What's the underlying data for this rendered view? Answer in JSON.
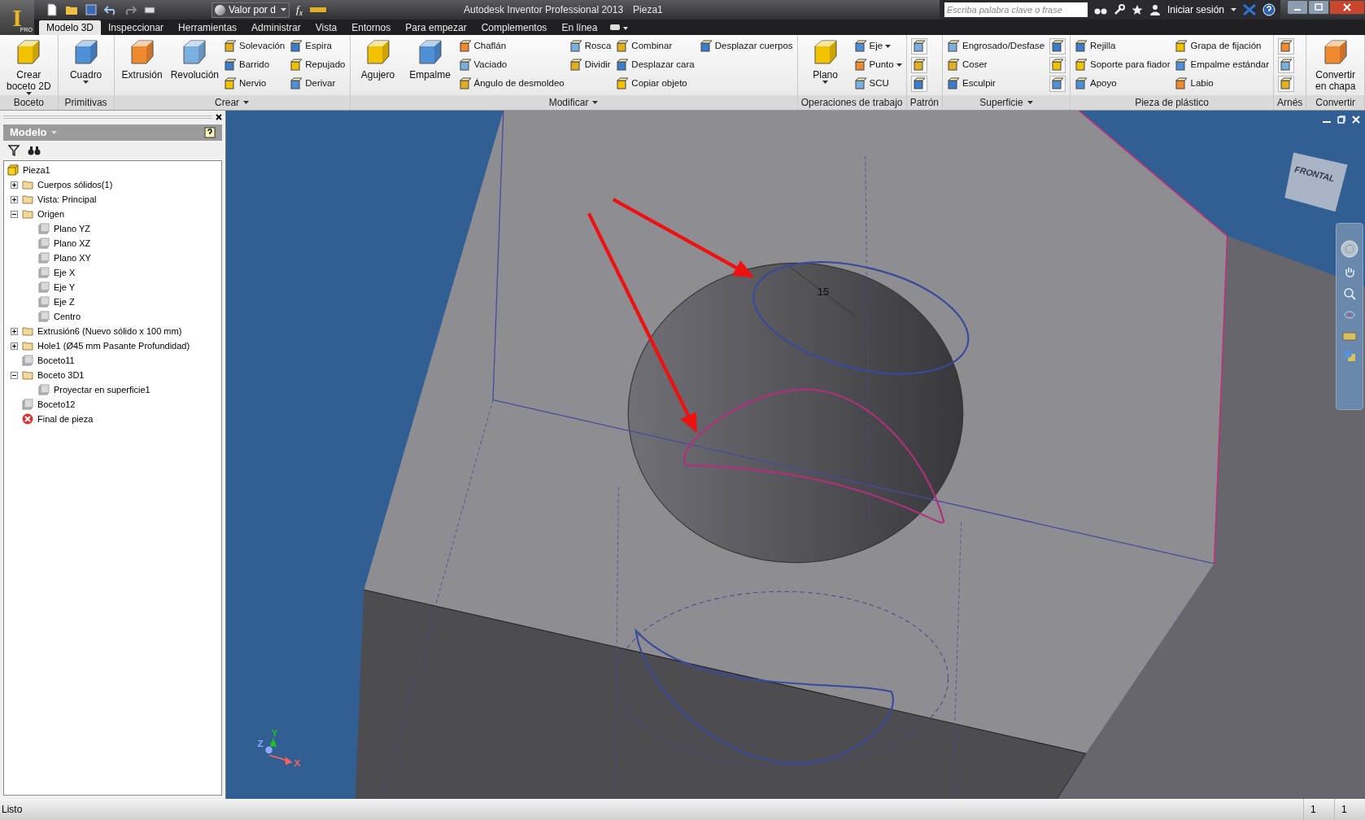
{
  "title_bar": {
    "logo_letter": "I",
    "logo_badge": "PRO",
    "style_dropdown": "Valor por d",
    "formula_label": "f$_{x}$",
    "title": "Autodesk Inventor Professional 2013",
    "document": "Pieza1",
    "search_placeholder": "Escriba palabra clave o frase",
    "sign_in": "Iniciar sesión"
  },
  "tabs": [
    {
      "label": "Modelo 3D",
      "selected": true
    },
    {
      "label": "Inspeccionar",
      "selected": false
    },
    {
      "label": "Herramientas",
      "selected": false
    },
    {
      "label": "Administrar",
      "selected": false
    },
    {
      "label": "Vista",
      "selected": false
    },
    {
      "label": "Entornos",
      "selected": false
    },
    {
      "label": "Para empezar",
      "selected": false
    },
    {
      "label": "Complementos",
      "selected": false
    },
    {
      "label": "En línea",
      "selected": false
    }
  ],
  "ribbon": {
    "panels": [
      {
        "title": "Boceto",
        "has_menu": false,
        "columns": [
          {
            "kind": "large",
            "label": "Crear boceto 2D",
            "dropdown": true
          }
        ]
      },
      {
        "title": "Primitivas",
        "has_menu": false,
        "columns": [
          {
            "kind": "large",
            "label": "Cuadro",
            "dropdown": true
          }
        ]
      },
      {
        "title": "Crear",
        "has_menu": true,
        "columns": [
          {
            "kind": "large",
            "label": "Extrusión",
            "dropdown": false
          },
          {
            "kind": "large",
            "label": "Revolución",
            "dropdown": false
          },
          {
            "kind": "stack",
            "items": [
              {
                "label": "Solevación",
                "dropdown": false
              },
              {
                "label": "Barrido",
                "dropdown": false
              },
              {
                "label": "Nervio",
                "dropdown": false
              }
            ]
          },
          {
            "kind": "stack",
            "items": [
              {
                "label": "Espira",
                "dropdown": false
              },
              {
                "label": "Repujado",
                "dropdown": false
              },
              {
                "label": "Derivar",
                "dropdown": false
              }
            ]
          }
        ]
      },
      {
        "title": "Modificar",
        "has_menu": true,
        "columns": [
          {
            "kind": "large",
            "label": "Agujero",
            "dropdown": false
          },
          {
            "kind": "large",
            "label": "Empalme",
            "dropdown": false
          },
          {
            "kind": "stack",
            "items": [
              {
                "label": "Chaflán",
                "dropdown": false
              },
              {
                "label": "Vaciado",
                "dropdown": false
              },
              {
                "label": "Ángulo de desmoldeo",
                "dropdown": false
              }
            ]
          },
          {
            "kind": "stack",
            "items": [
              {
                "label": "Rosca",
                "dropdown": false
              },
              {
                "label": "Dividir",
                "dropdown": false
              }
            ]
          },
          {
            "kind": "stack",
            "items": [
              {
                "label": "Combinar",
                "dropdown": false
              },
              {
                "label": "Desplazar cara",
                "dropdown": false
              },
              {
                "label": "Copiar objeto",
                "dropdown": false
              }
            ]
          },
          {
            "kind": "stack",
            "items": [
              {
                "label": "Desplazar cuerpos",
                "dropdown": false
              }
            ]
          }
        ]
      },
      {
        "title": "Operaciones de trabajo",
        "has_menu": false,
        "columns": [
          {
            "kind": "large",
            "label": "Plano",
            "dropdown": true
          },
          {
            "kind": "stack",
            "items": [
              {
                "label": "Eje",
                "dropdown": true
              },
              {
                "label": "Punto",
                "dropdown": true
              },
              {
                "label": "SCU",
                "dropdown": false
              }
            ]
          }
        ]
      },
      {
        "title": "Patrón",
        "has_menu": false,
        "columns": [
          {
            "kind": "icons"
          }
        ]
      },
      {
        "title": "Superficie",
        "has_menu": true,
        "columns": [
          {
            "kind": "stack",
            "items": [
              {
                "label": "Engrosado/Desfase",
                "dropdown": false
              },
              {
                "label": "Coser",
                "dropdown": false
              },
              {
                "label": "Esculpir",
                "dropdown": false
              }
            ]
          },
          {
            "kind": "icons"
          }
        ]
      },
      {
        "title": "Pieza de plástico",
        "has_menu": false,
        "columns": [
          {
            "kind": "stack",
            "items": [
              {
                "label": "Rejilla",
                "dropdown": false
              },
              {
                "label": "Soporte para fiador",
                "dropdown": false
              },
              {
                "label": "Apoyo",
                "dropdown": false
              }
            ]
          },
          {
            "kind": "stack",
            "items": [
              {
                "label": "Grapa de fijación",
                "dropdown": false
              },
              {
                "label": "Empalme estándar",
                "dropdown": false
              },
              {
                "label": "Labio",
                "dropdown": false
              }
            ]
          }
        ]
      },
      {
        "title": "Arnés",
        "has_menu": false,
        "columns": [
          {
            "kind": "icons"
          }
        ]
      },
      {
        "title": "Convertir",
        "has_menu": false,
        "columns": [
          {
            "kind": "large",
            "label": "Convertir en chapa",
            "dropdown": false
          }
        ]
      }
    ]
  },
  "browser": {
    "title": "Modelo",
    "tree": [
      {
        "label": "Pieza1",
        "kind": "root",
        "children": [
          {
            "label": "Cuerpos sólidos(1)",
            "kind": "collapsible",
            "expanded": false
          },
          {
            "label": "Vista: Principal",
            "kind": "collapsible",
            "expanded": false
          },
          {
            "label": "Origen",
            "kind": "collapsible",
            "expanded": true,
            "children": [
              {
                "label": "Plano YZ",
                "kind": "leaf"
              },
              {
                "label": "Plano XZ",
                "kind": "leaf"
              },
              {
                "label": "Plano XY",
                "kind": "leaf"
              },
              {
                "label": "Eje X",
                "kind": "leaf"
              },
              {
                "label": "Eje Y",
                "kind": "leaf"
              },
              {
                "label": "Eje Z",
                "kind": "leaf"
              },
              {
                "label": "Centro",
                "kind": "leaf"
              }
            ]
          },
          {
            "label": "Extrusión6 (Nuevo sólido x 100 mm)",
            "kind": "collapsible",
            "expanded": false
          },
          {
            "label": "Hole1 (Ø45 mm Pasante Profundidad)",
            "kind": "collapsible",
            "expanded": false
          },
          {
            "label": "Boceto11",
            "kind": "leaf"
          },
          {
            "label": "Boceto 3D1",
            "kind": "collapsible",
            "expanded": true,
            "children": [
              {
                "label": "Proyectar en superficie1",
                "kind": "leaf"
              }
            ]
          },
          {
            "label": "Boceto12",
            "kind": "leaf"
          },
          {
            "label": "Final de pieza",
            "kind": "end"
          }
        ]
      }
    ]
  },
  "viewport": {
    "dimension": "15",
    "viewcube_label": "FRONTAL",
    "axes": [
      {
        "label": "X",
        "color": "#ff6060"
      },
      {
        "label": "Y",
        "color": "#20c020"
      },
      {
        "label": "Z",
        "color": "#90a8ff"
      }
    ]
  },
  "status_bar": {
    "message": "Listo",
    "fields": [
      "1",
      "1"
    ]
  }
}
